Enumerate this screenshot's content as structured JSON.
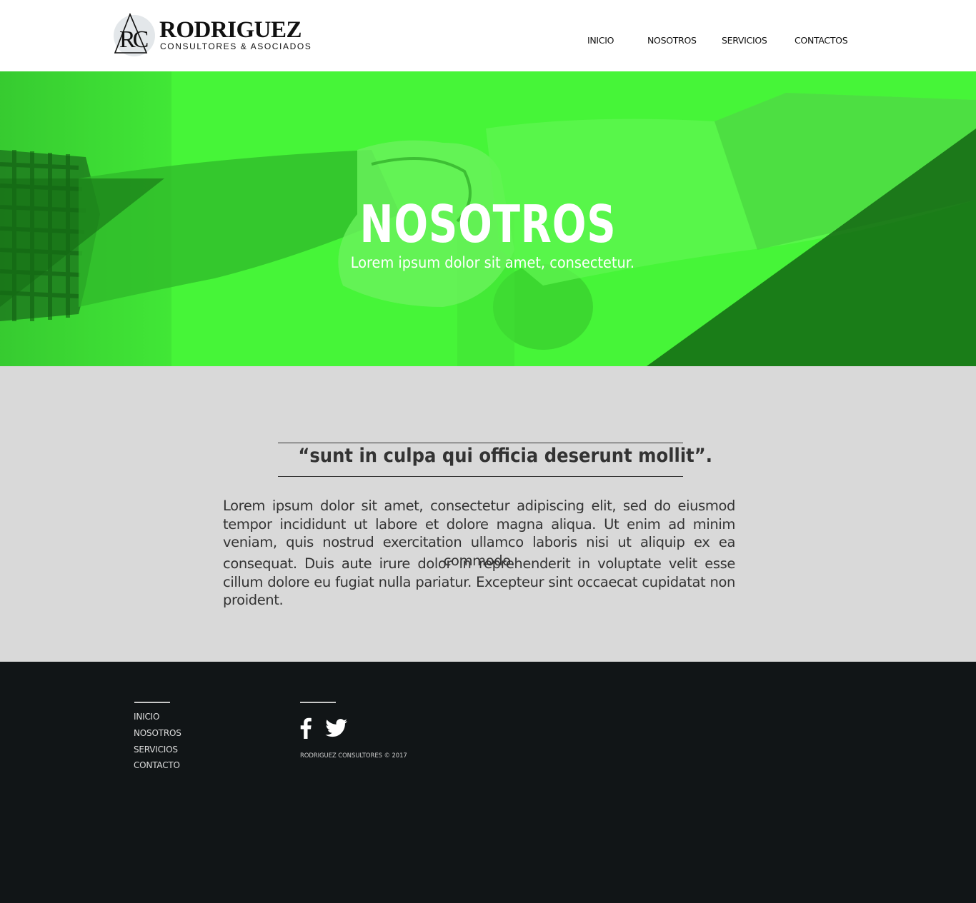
{
  "brand": {
    "name": "RODRIGUEZ",
    "tagline": "CONSULTORES & ASOCIADOS",
    "monogram": "RC"
  },
  "nav": {
    "items": [
      {
        "label": "INICIO"
      },
      {
        "label": "NOSOTROS"
      },
      {
        "label": "SERVICIOS"
      },
      {
        "label": "CONTACTOS"
      }
    ]
  },
  "hero": {
    "title": "NOSOTROS",
    "subtitle": "Lorem ipsum dolor sit amet, consectetur.",
    "overlay_color": "#46f538"
  },
  "content": {
    "quote": "“sunt in culpa qui officia deserunt mollit”.",
    "paragraph_1": "Lorem ipsum dolor sit amet, consectetur adipiscing elit, sed do eiusmod tempor incididunt ut labore et dolore magna aliqua. Ut enim ad minim veniam, quis nostrud exercitation ullamco laboris nisi ut aliquip ex ea commodo.",
    "paragraph_2": "consequat. Duis aute irure dolor in reprehenderit in voluptate velit esse cillum dolore eu fugiat nulla pariatur. Excepteur sint occaecat cupidatat non proident."
  },
  "footer": {
    "links": [
      {
        "label": "INICIO"
      },
      {
        "label": "NOSOTROS"
      },
      {
        "label": "SERVICIOS"
      },
      {
        "label": "CONTACTO"
      }
    ],
    "social": [
      {
        "icon": "facebook-icon"
      },
      {
        "icon": "twitter-icon"
      }
    ],
    "copyright": "RODRIGUEZ CONSULTORES © 2017"
  },
  "colors": {
    "accent_green": "#46f538",
    "dark_green": "#1a7a1a",
    "content_bg": "#d9d9d9",
    "footer_bg": "#111517",
    "text_dark": "#333333"
  }
}
